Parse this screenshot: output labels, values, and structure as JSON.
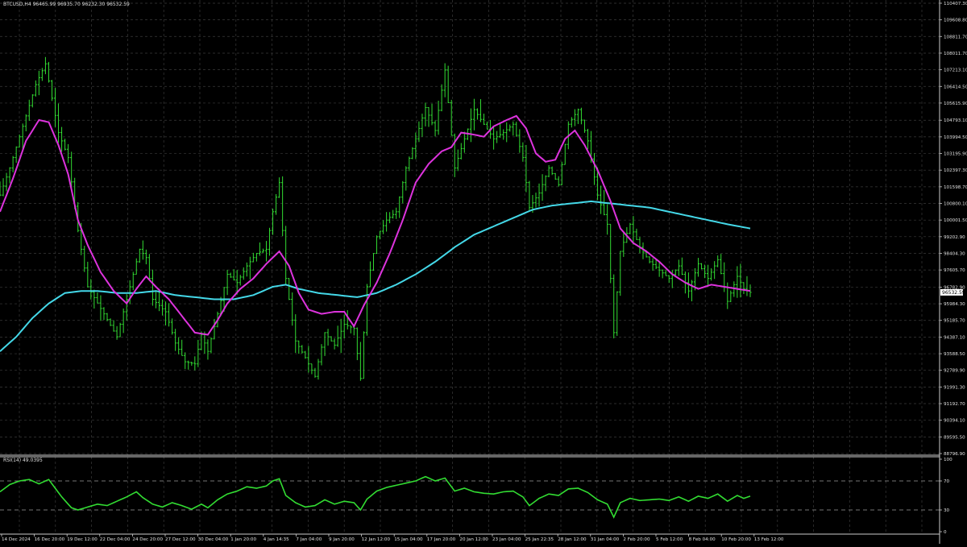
{
  "header": {
    "main_label": "BTCUSD,H4",
    "ohlc": "96465.99 96935.70 96232.30 96532.59",
    "rsi_label": "RSI(14) 49.0395"
  },
  "colors": {
    "background": "#000000",
    "grid": "#3a3a3a",
    "bars": "#32dc32",
    "ma_fast": "#dd33dd",
    "ma_slow": "#44d8e8",
    "rsi": "#32dc32",
    "text": "#e0e0e0",
    "price_tag_bg": "#ffffff",
    "price_tag_text": "#000000"
  },
  "chart_data": [
    {
      "type": "candlestick",
      "title": "BTCUSD,H4",
      "y_ticks": [
        "110407.30",
        "109608.80",
        "108811.70",
        "108011.70",
        "107213.10",
        "106414.50",
        "105615.90",
        "104793.10",
        "103994.50",
        "103195.90",
        "102397.30",
        "101598.70",
        "100800.10",
        "100001.50",
        "99202.90",
        "98404.30",
        "97605.70",
        "96782.90",
        "95984.30",
        "95185.70",
        "94387.10",
        "93588.50",
        "92789.90",
        "91991.30",
        "91192.70",
        "90394.10",
        "89595.50",
        "88796.90"
      ],
      "ylim": [
        88796.9,
        110407.3
      ],
      "x_ticks": [
        "14 Dec 2024",
        "16 Dec 20:00",
        "19 Dec 12:00",
        "22 Dec 04:00",
        "24 Dec 20:00",
        "27 Dec 12:00",
        "30 Dec 04:00",
        "1 Jan 20:00",
        "4 Jan 14:35",
        "7 Jan 04:00",
        "9 Jan 20:00",
        "12 Jan 12:00",
        "15 Jan 04:00",
        "17 Jan 20:00",
        "20 Jan 12:00",
        "23 Jan 04:00",
        "25 Jan 22:35",
        "28 Jan 12:00",
        "31 Jan 04:00",
        "2 Feb 20:00",
        "5 Feb 12:00",
        "8 Feb 04:00",
        "10 Feb 20:00",
        "13 Feb 12:00"
      ],
      "last_price": "96532.59",
      "anchors": [
        [
          0,
          101200
        ],
        [
          3,
          102500
        ],
        [
          7,
          104500
        ],
        [
          11,
          106500
        ],
        [
          14,
          107500
        ],
        [
          18,
          104200
        ],
        [
          21,
          103000
        ],
        [
          24,
          99500
        ],
        [
          27,
          96800
        ],
        [
          32,
          95500
        ],
        [
          36,
          94400
        ],
        [
          40,
          96800
        ],
        [
          43,
          98600
        ],
        [
          45,
          98200
        ],
        [
          47,
          96200
        ],
        [
          51,
          95600
        ],
        [
          54,
          94100
        ],
        [
          57,
          93200
        ],
        [
          60,
          93100
        ],
        [
          62,
          94500
        ],
        [
          64,
          93700
        ],
        [
          67,
          95500
        ],
        [
          70,
          97400
        ],
        [
          73,
          97000
        ],
        [
          76,
          97800
        ],
        [
          79,
          98400
        ],
        [
          82,
          98600
        ],
        [
          84,
          100400
        ],
        [
          86,
          101800
        ],
        [
          88,
          97200
        ],
        [
          91,
          94200
        ],
        [
          94,
          93400
        ],
        [
          97,
          92500
        ],
        [
          100,
          94600
        ],
        [
          103,
          94000
        ],
        [
          106,
          95000
        ],
        [
          109,
          94800
        ],
        [
          111,
          92400
        ],
        [
          113,
          96800
        ],
        [
          116,
          99200
        ],
        [
          119,
          100000
        ],
        [
          122,
          100400
        ],
        [
          125,
          102500
        ],
        [
          128,
          103900
        ],
        [
          131,
          105400
        ],
        [
          134,
          104300
        ],
        [
          137,
          107200
        ],
        [
          140,
          102500
        ],
        [
          143,
          103900
        ],
        [
          146,
          105300
        ],
        [
          149,
          104600
        ],
        [
          152,
          103900
        ],
        [
          155,
          104200
        ],
        [
          158,
          104600
        ],
        [
          161,
          103000
        ],
        [
          163,
          100600
        ],
        [
          166,
          101300
        ],
        [
          169,
          102500
        ],
        [
          172,
          101700
        ],
        [
          175,
          104600
        ],
        [
          178,
          105300
        ],
        [
          181,
          103800
        ],
        [
          184,
          101200
        ],
        [
          187,
          99800
        ],
        [
          189,
          94600
        ],
        [
          191,
          98500
        ],
        [
          194,
          99800
        ],
        [
          197,
          98700
        ],
        [
          200,
          98000
        ],
        [
          203,
          97600
        ],
        [
          206,
          97200
        ],
        [
          209,
          97800
        ],
        [
          212,
          96600
        ],
        [
          215,
          97900
        ],
        [
          218,
          97200
        ],
        [
          221,
          98100
        ],
        [
          224,
          96100
        ],
        [
          227,
          97300
        ],
        [
          229,
          96700
        ],
        [
          231,
          96533
        ]
      ],
      "series": [
        {
          "name": "",
          "style": "line",
          "anchors": [
            [
              0,
              100400
            ],
            [
              4,
              102000
            ],
            [
              8,
              103800
            ],
            [
              12,
              104800
            ],
            [
              15,
              104700
            ],
            [
              18,
              103600
            ],
            [
              21,
              102200
            ],
            [
              24,
              100000
            ],
            [
              27,
              98800
            ],
            [
              31,
              97500
            ],
            [
              35,
              96600
            ],
            [
              39,
              96000
            ],
            [
              42,
              96700
            ],
            [
              45,
              97300
            ],
            [
              48,
              96800
            ],
            [
              52,
              96200
            ],
            [
              56,
              95400
            ],
            [
              60,
              94600
            ],
            [
              64,
              94500
            ],
            [
              67,
              95200
            ],
            [
              70,
              96000
            ],
            [
              74,
              96700
            ],
            [
              78,
              97200
            ],
            [
              82,
              97900
            ],
            [
              86,
              98500
            ],
            [
              89,
              97800
            ],
            [
              92,
              96500
            ],
            [
              95,
              95700
            ],
            [
              99,
              95500
            ],
            [
              103,
              95600
            ],
            [
              106,
              95600
            ],
            [
              109,
              94900
            ],
            [
              112,
              95900
            ],
            [
              116,
              97000
            ],
            [
              120,
              98400
            ],
            [
              124,
              100000
            ],
            [
              128,
              101800
            ],
            [
              132,
              102700
            ],
            [
              136,
              103300
            ],
            [
              139,
              103500
            ],
            [
              142,
              104200
            ],
            [
              146,
              104100
            ],
            [
              149,
              104000
            ],
            [
              152,
              104500
            ],
            [
              156,
              104800
            ],
            [
              159,
              105000
            ],
            [
              162,
              104400
            ],
            [
              165,
              103200
            ],
            [
              168,
              102800
            ],
            [
              171,
              102900
            ],
            [
              174,
              103900
            ],
            [
              177,
              104300
            ],
            [
              180,
              103600
            ],
            [
              184,
              102400
            ],
            [
              188,
              100900
            ],
            [
              191,
              99600
            ],
            [
              195,
              98900
            ],
            [
              199,
              98500
            ],
            [
              203,
              98000
            ],
            [
              207,
              97400
            ],
            [
              211,
              97000
            ],
            [
              215,
              96700
            ],
            [
              219,
              96900
            ],
            [
              223,
              96800
            ],
            [
              227,
              96700
            ],
            [
              231,
              96600
            ]
          ]
        },
        {
          "name": "",
          "style": "line",
          "anchors": [
            [
              0,
              93700
            ],
            [
              5,
              94400
            ],
            [
              10,
              95300
            ],
            [
              15,
              96000
            ],
            [
              20,
              96500
            ],
            [
              25,
              96600
            ],
            [
              30,
              96600
            ],
            [
              36,
              96500
            ],
            [
              42,
              96500
            ],
            [
              48,
              96600
            ],
            [
              54,
              96400
            ],
            [
              60,
              96300
            ],
            [
              66,
              96200
            ],
            [
              72,
              96200
            ],
            [
              78,
              96400
            ],
            [
              84,
              96800
            ],
            [
              88,
              96900
            ],
            [
              92,
              96700
            ],
            [
              98,
              96500
            ],
            [
              104,
              96400
            ],
            [
              110,
              96300
            ],
            [
              116,
              96500
            ],
            [
              122,
              96900
            ],
            [
              128,
              97400
            ],
            [
              134,
              98000
            ],
            [
              140,
              98700
            ],
            [
              146,
              99300
            ],
            [
              152,
              99700
            ],
            [
              158,
              100100
            ],
            [
              164,
              100500
            ],
            [
              170,
              100700
            ],
            [
              176,
              100800
            ],
            [
              182,
              100900
            ],
            [
              188,
              100800
            ],
            [
              194,
              100700
            ],
            [
              200,
              100600
            ],
            [
              206,
              100400
            ],
            [
              212,
              100200
            ],
            [
              218,
              100000
            ],
            [
              224,
              99800
            ],
            [
              231,
              99600
            ]
          ]
        }
      ]
    },
    {
      "type": "line",
      "title": "RSI(14) 49.0395",
      "y_ticks": [
        "100",
        "70",
        "30",
        "0"
      ],
      "ylim": [
        0,
        100
      ],
      "levels": [
        70,
        30
      ],
      "anchors": [
        [
          0,
          55
        ],
        [
          3,
          65
        ],
        [
          6,
          70
        ],
        [
          9,
          72
        ],
        [
          12,
          66
        ],
        [
          15,
          72
        ],
        [
          17,
          60
        ],
        [
          19,
          48
        ],
        [
          22,
          33
        ],
        [
          24,
          30
        ],
        [
          27,
          34
        ],
        [
          30,
          38
        ],
        [
          33,
          36
        ],
        [
          36,
          42
        ],
        [
          39,
          48
        ],
        [
          42,
          55
        ],
        [
          44,
          47
        ],
        [
          47,
          38
        ],
        [
          50,
          34
        ],
        [
          53,
          40
        ],
        [
          56,
          36
        ],
        [
          59,
          31
        ],
        [
          62,
          38
        ],
        [
          64,
          33
        ],
        [
          67,
          44
        ],
        [
          70,
          52
        ],
        [
          73,
          56
        ],
        [
          76,
          62
        ],
        [
          79,
          60
        ],
        [
          82,
          63
        ],
        [
          84,
          70
        ],
        [
          86,
          73
        ],
        [
          88,
          50
        ],
        [
          91,
          40
        ],
        [
          94,
          34
        ],
        [
          97,
          36
        ],
        [
          100,
          44
        ],
        [
          103,
          38
        ],
        [
          106,
          42
        ],
        [
          109,
          40
        ],
        [
          111,
          30
        ],
        [
          113,
          45
        ],
        [
          116,
          56
        ],
        [
          119,
          61
        ],
        [
          122,
          64
        ],
        [
          125,
          67
        ],
        [
          128,
          70
        ],
        [
          131,
          76
        ],
        [
          134,
          70
        ],
        [
          137,
          74
        ],
        [
          140,
          56
        ],
        [
          143,
          60
        ],
        [
          146,
          55
        ],
        [
          149,
          53
        ],
        [
          152,
          52
        ],
        [
          155,
          55
        ],
        [
          158,
          56
        ],
        [
          161,
          48
        ],
        [
          163,
          36
        ],
        [
          166,
          46
        ],
        [
          169,
          52
        ],
        [
          172,
          50
        ],
        [
          175,
          59
        ],
        [
          178,
          60
        ],
        [
          181,
          54
        ],
        [
          184,
          44
        ],
        [
          187,
          38
        ],
        [
          189,
          20
        ],
        [
          191,
          40
        ],
        [
          194,
          46
        ],
        [
          197,
          43
        ],
        [
          200,
          44
        ],
        [
          203,
          45
        ],
        [
          206,
          43
        ],
        [
          209,
          48
        ],
        [
          212,
          42
        ],
        [
          215,
          49
        ],
        [
          218,
          46
        ],
        [
          221,
          52
        ],
        [
          224,
          42
        ],
        [
          227,
          50
        ],
        [
          229,
          46
        ],
        [
          231,
          49
        ]
      ]
    }
  ]
}
